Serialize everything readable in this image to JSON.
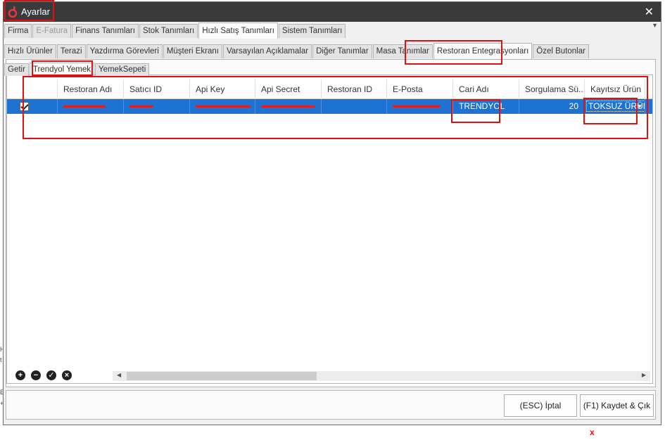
{
  "window": {
    "title": "Ayarlar",
    "close_glyph": "✕",
    "icon": "app-logo-icon"
  },
  "tabs_main": [
    {
      "label": "Firma",
      "state": "normal"
    },
    {
      "label": "E-Fatura",
      "state": "disabled"
    },
    {
      "label": "Finans Tanımları",
      "state": "normal"
    },
    {
      "label": "Stok Tanımları",
      "state": "normal"
    },
    {
      "label": "Hızlı Satış Tanımları",
      "state": "active"
    },
    {
      "label": "Sistem Tanımları",
      "state": "normal"
    }
  ],
  "tabs_sub": [
    {
      "label": "Hızlı Ürünler"
    },
    {
      "label": "Terazi"
    },
    {
      "label": "Yazdırma Görevleri"
    },
    {
      "label": "Müşteri Ekranı"
    },
    {
      "label": "Varsayılan Açıklamalar"
    },
    {
      "label": "Diğer Tanımlar"
    },
    {
      "label": "Masa Tanımlar"
    },
    {
      "label": "Restoran Entegrasyonları"
    },
    {
      "label": "Özel Butonlar"
    }
  ],
  "tabs_integration": [
    {
      "label": "Getir"
    },
    {
      "label": "Trendyol Yemek"
    },
    {
      "label": "YemekSepeti"
    }
  ],
  "grid": {
    "columns": [
      "",
      "Restoran Adı",
      "Satıcı ID",
      "Api Key",
      "Api Secret",
      "Restoran ID",
      "E-Posta",
      "Cari Adı",
      "Sorgulama Sü...",
      "Kayıtsız Ürün"
    ],
    "row": {
      "checked": true,
      "cari_adi": "TRENDYOL",
      "sorgulama_suresi": "20",
      "kayitsiz_urun": "TOKSUZ ÜRÜN"
    }
  },
  "buttons": {
    "cancel": "(ESC) İptal",
    "save": "(F1) Kaydet & Çık"
  },
  "extra": {
    "x_mark": "x"
  },
  "colors": {
    "selection": "#1e73d2",
    "highlight": "#e01010",
    "titlebar": "#3a3a3a"
  }
}
